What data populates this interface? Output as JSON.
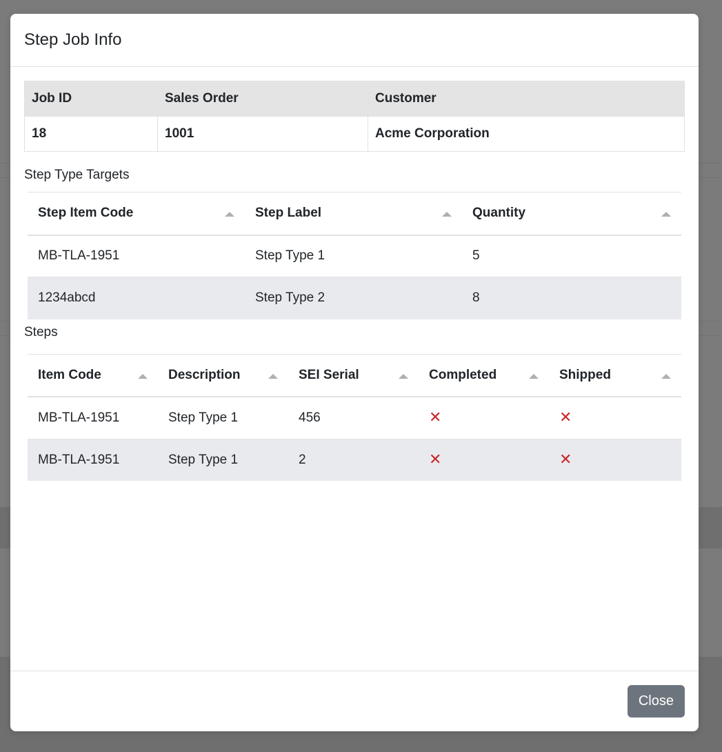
{
  "modal": {
    "title": "Step Job Info",
    "close_label": "Close"
  },
  "job_info": {
    "headers": [
      "Job ID",
      "Sales Order",
      "Customer"
    ],
    "values": [
      "18",
      "1001",
      "Acme Corporation"
    ]
  },
  "step_type_targets": {
    "label": "Step Type Targets",
    "headers": [
      "Step Item Code",
      "Step Label",
      "Quantity"
    ],
    "rows": [
      [
        "MB-TLA-1951",
        "Step Type 1",
        "5"
      ],
      [
        "1234abcd",
        "Step Type 2",
        "8"
      ]
    ]
  },
  "steps": {
    "label": "Steps",
    "headers": [
      "Item Code",
      "Description",
      "SEI Serial",
      "Completed",
      "Shipped"
    ],
    "rows": [
      {
        "item_code": "MB-TLA-1951",
        "description": "Step Type 1",
        "sei_serial": "456",
        "completed": false,
        "shipped": false
      },
      {
        "item_code": "MB-TLA-1951",
        "description": "Step Type 1",
        "sei_serial": "2",
        "completed": false,
        "shipped": false
      }
    ]
  },
  "icons": {
    "sort": "sort-caret-up-icon",
    "not_done": "x-mark-icon"
  },
  "colors": {
    "x_mark": "#c62828",
    "close_button": "#6c757d",
    "striped_row": "#e9eaee",
    "info_header": "#e4e4e4"
  }
}
